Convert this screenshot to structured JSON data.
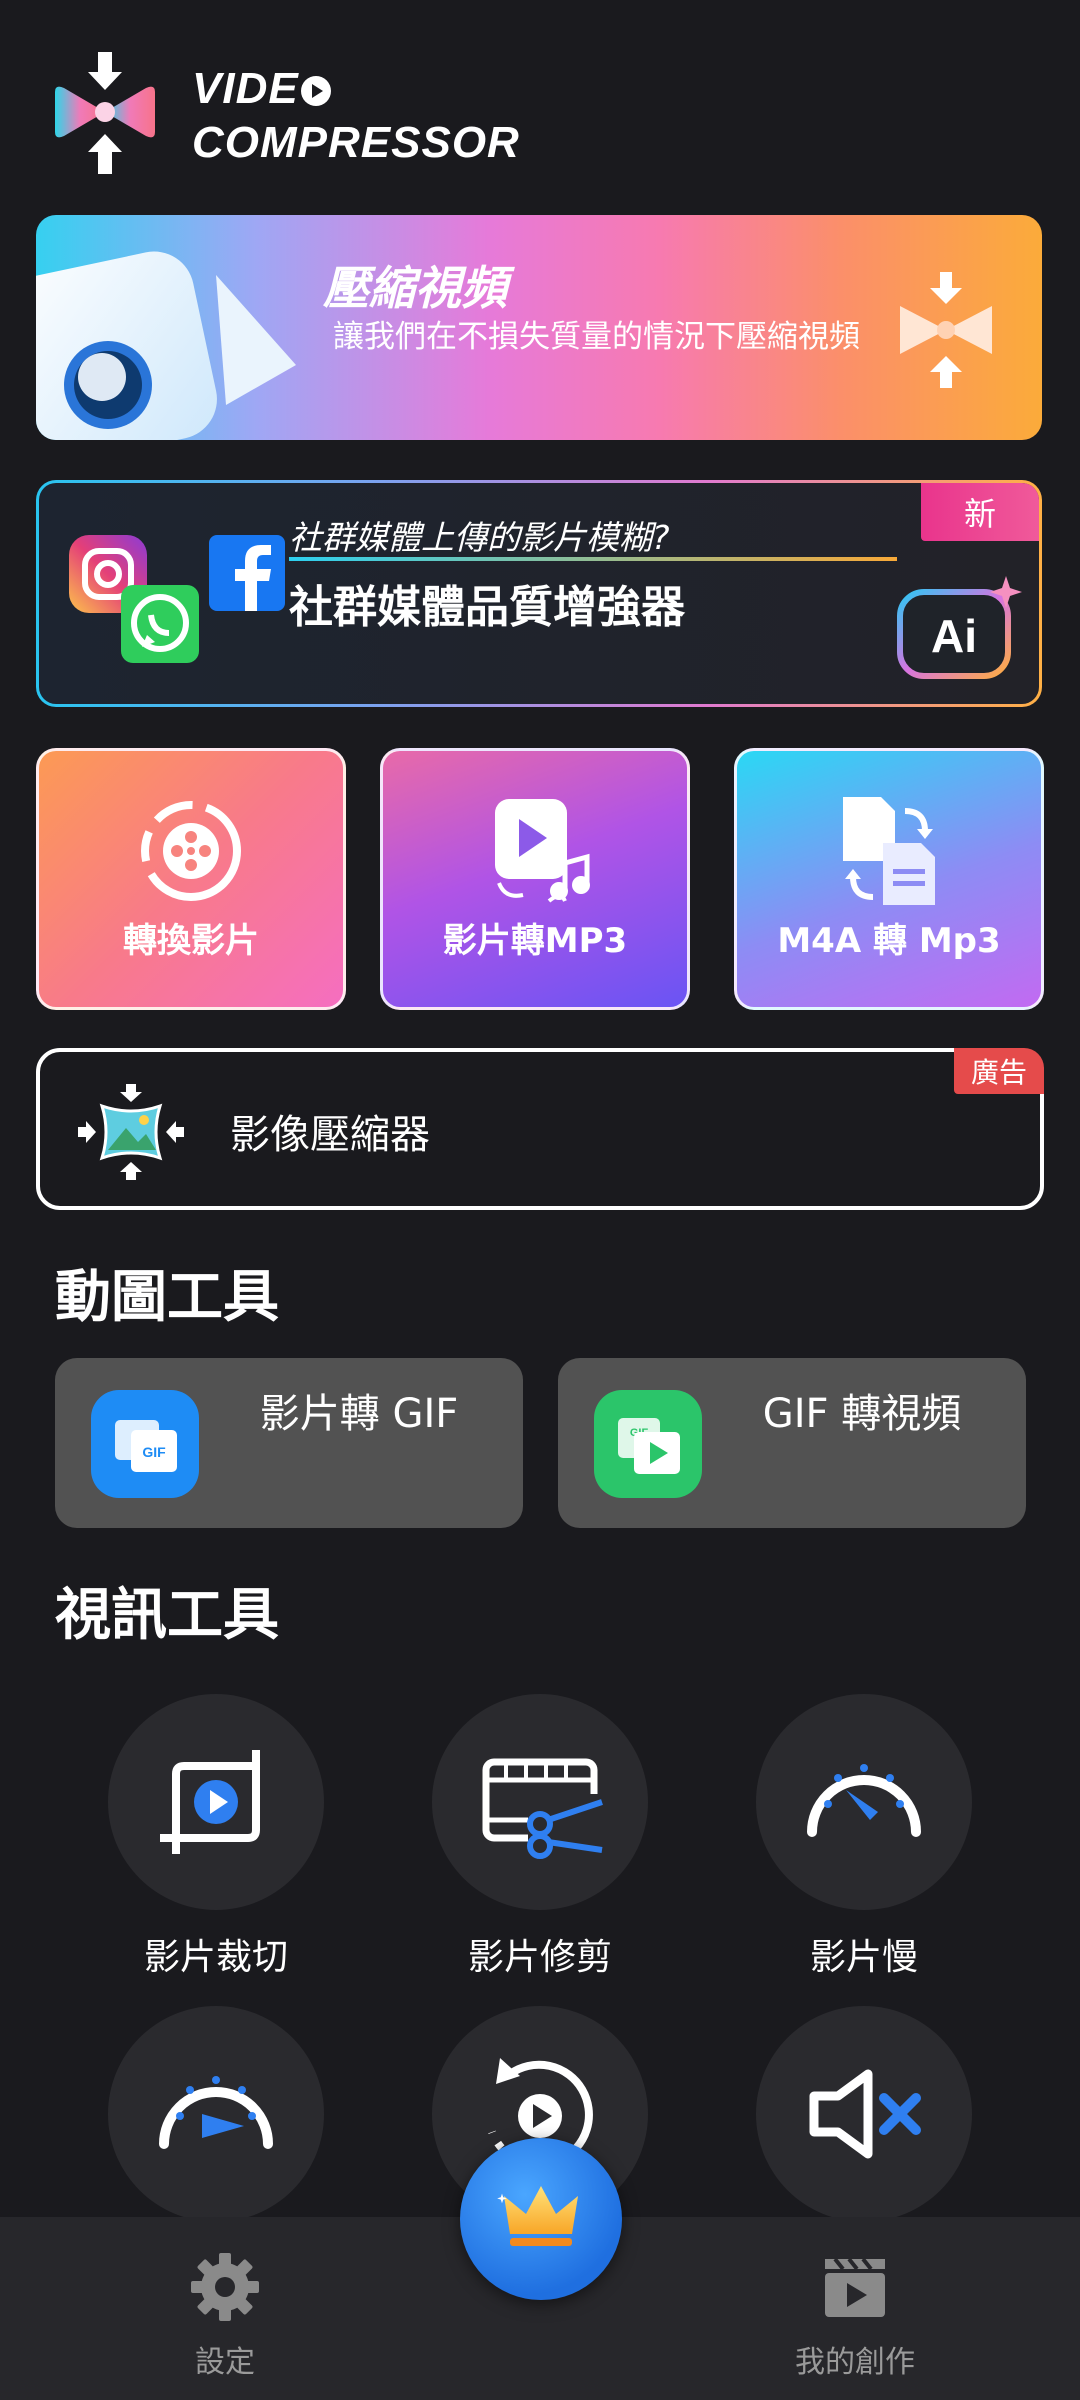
{
  "app": {
    "brand_line1": "VIDE",
    "brand_line2": "COMPRESSOR"
  },
  "banner_compress": {
    "title": "壓縮視頻",
    "description": "讓我們在不損失質量的情況下壓縮視頻"
  },
  "banner_social": {
    "badge": "新",
    "question": "社群媒體上傳的影片模糊?",
    "title": "社群媒體品質增強器",
    "ai_label": "Ai"
  },
  "tools": [
    {
      "label": "轉換影片"
    },
    {
      "label": "影片轉MP3"
    },
    {
      "label": "M4A 轉 Mp3"
    }
  ],
  "image_compressor": {
    "label": "影像壓縮器",
    "ad_badge": "廣告"
  },
  "gif_section": {
    "title": "動圖工具",
    "items": [
      {
        "label": "影片轉 GIF",
        "icon": "video-to-gif-icon",
        "color": "#1e8cf5"
      },
      {
        "label": "GIF 轉視頻",
        "icon": "gif-to-video-icon",
        "color": "#2bc56a"
      }
    ]
  },
  "video_section": {
    "title": "視訊工具",
    "items": [
      {
        "label": "影片裁切",
        "icon": "crop-video-icon"
      },
      {
        "label": "影片修剪",
        "icon": "trim-video-icon"
      },
      {
        "label": "影片慢",
        "icon": "slow-motion-icon"
      },
      {
        "label": "",
        "icon": "fast-motion-icon"
      },
      {
        "label": "",
        "icon": "reverse-video-icon"
      },
      {
        "label": "",
        "icon": "mute-video-icon"
      }
    ]
  },
  "bottom_nav": {
    "settings": "設定",
    "my_creations": "我的創作"
  },
  "colors": {
    "background": "#1a1a1e",
    "accent_blue": "#2f7ff0",
    "card_gray": "#525252"
  }
}
